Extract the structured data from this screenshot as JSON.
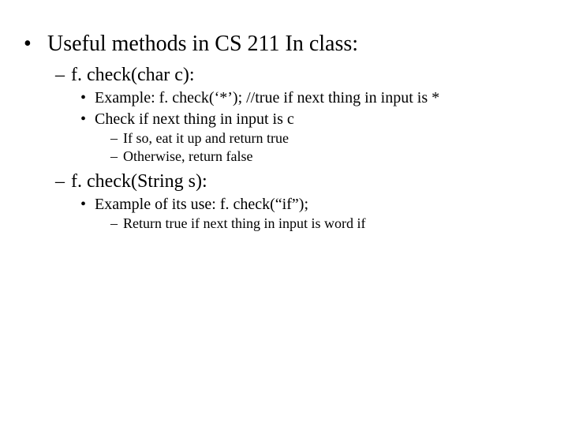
{
  "l1": "Useful methods in CS 211 In class:",
  "method1": {
    "title": "f. check(char c):",
    "ex": "Example: f. check(‘*’); //true if next thing in input is *",
    "desc": "Check if next thing in input is c",
    "sub1": "If so, eat it up and return true",
    "sub2": "Otherwise, return false"
  },
  "method2": {
    "title": "f. check(String s):",
    "ex": "Example of its use: f. check(“if”);",
    "sub1": "Return true if next thing in input is word if"
  }
}
